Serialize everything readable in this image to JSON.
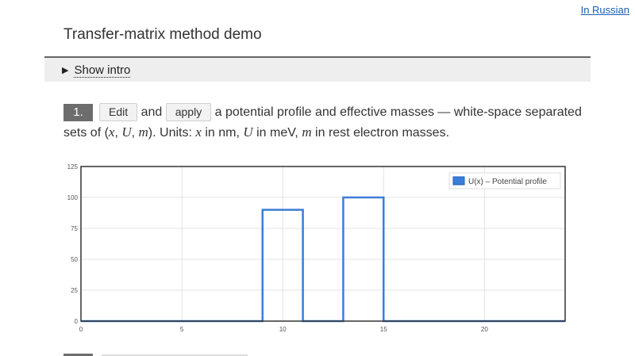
{
  "header": {
    "lang_link": "In Russian",
    "title": "Transfer-matrix method demo"
  },
  "intro": {
    "summary": "Show intro"
  },
  "step1": {
    "number": "1.",
    "edit_label": "Edit",
    "and_text": "and",
    "apply_label": "apply",
    "text_a": "a potential profile and effective masses — white-space separated sets of (",
    "var_x": "x",
    "comma1": ", ",
    "var_U": "U",
    "comma2": ", ",
    "var_m": "m",
    "text_b": "). Units: ",
    "var_x2": "x",
    "text_c": " in nm, ",
    "var_U2": "U",
    "text_d": " in meV, ",
    "var_m2": "m",
    "text_e": " in rest electron masses."
  },
  "chart_data": {
    "type": "line",
    "xlim": [
      0,
      24
    ],
    "ylim": [
      0,
      125
    ],
    "x_ticks": [
      0,
      5,
      10,
      15,
      20
    ],
    "y_ticks": [
      0,
      25,
      50,
      75,
      100,
      125
    ],
    "grid": true,
    "legend_position": "top-right",
    "series": [
      {
        "name": "U(x) – Potential profile",
        "color": "#3b7dd8",
        "x": [
          0,
          9,
          9,
          11,
          11,
          13,
          13,
          15,
          15,
          24
        ],
        "y": [
          0,
          0,
          90,
          90,
          0,
          0,
          100,
          100,
          0,
          0
        ]
      }
    ]
  },
  "colors": {
    "series": "#3b7dd8",
    "step_badge": "#6d6d6d",
    "intro_bg": "#eeeeee"
  }
}
